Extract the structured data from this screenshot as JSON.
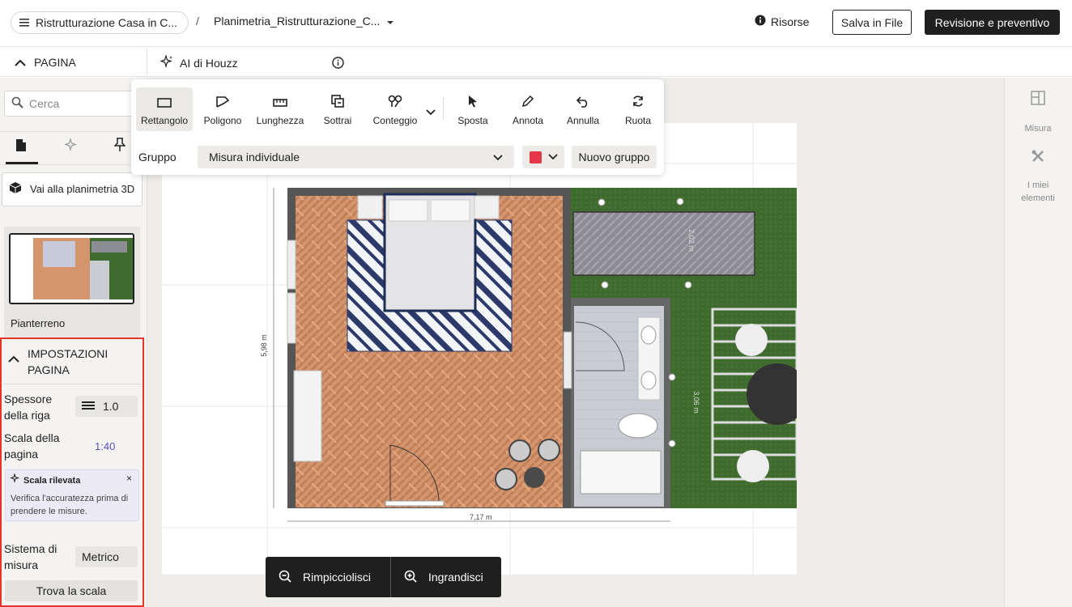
{
  "header": {
    "project_title": "Ristrutturazione Casa in C...",
    "separator": "/",
    "file_name": "Planimetria_Ristrutturazione_C...",
    "resources": "Risorse",
    "save_file": "Salva in File",
    "review": "Revisione e preventivo"
  },
  "subbar": {
    "page_section": "PAGINA",
    "ai": "AI di Houzz"
  },
  "left_panel": {
    "search_placeholder": "Cerca",
    "goto_3d": "Vai alla planimetria 3D",
    "page_name": "Pianterreno",
    "settings": {
      "title": "IMPOSTAZIONI PAGINA",
      "line_thickness_label": "Spessore della riga",
      "line_thickness_value": "1.0",
      "page_scale_label": "Scala della pagina",
      "page_scale_value": "1:40",
      "scale_detected_title": "Scala rilevata",
      "scale_detected_text": "Verifica l'accuratezza prima di prendere le misure.",
      "close": "×",
      "measure_system_label": "Sistema di misura",
      "measure_system_value": "Metrico",
      "find_scale": "Trova la scala"
    }
  },
  "toolbar": {
    "tools": [
      "Rettangolo",
      "Poligono",
      "Lunghezza",
      "Sottrai",
      "Conteggio",
      "Sposta",
      "Annota",
      "Annulla",
      "Ruota"
    ],
    "group_label": "Gruppo",
    "group_value": "Misura individuale",
    "group_color": "#e5374a",
    "new_group": "Nuovo gruppo"
  },
  "plan": {
    "dim_height": "5,98 m",
    "dim_width": "7,17 m",
    "dim_patio": "2,02 m",
    "dim_pergola": "3,06 m"
  },
  "right_panel": {
    "measure": "Misura",
    "my_items": "I miei elementi"
  },
  "zoom": {
    "zoom_out": "Rimpicciolisci",
    "zoom_in": "Ingrandisci"
  }
}
